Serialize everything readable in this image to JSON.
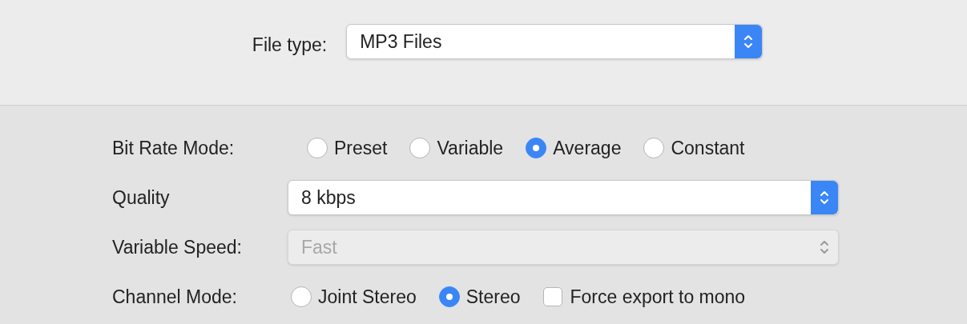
{
  "file_type": {
    "label": "File type:",
    "value": "MP3 Files"
  },
  "options": [
    {
      "kind": "radio",
      "label": "Bit Rate Mode:",
      "choices": [
        {
          "label": "Preset",
          "selected": false
        },
        {
          "label": "Variable",
          "selected": false
        },
        {
          "label": "Average",
          "selected": true
        },
        {
          "label": "Constant",
          "selected": false
        }
      ]
    },
    {
      "kind": "select",
      "label": "Quality",
      "value": "8 kbps",
      "disabled": false
    },
    {
      "kind": "select",
      "label": "Variable Speed:",
      "value": "Fast",
      "disabled": true
    },
    {
      "kind": "radio",
      "label": "Channel Mode:",
      "choices": [
        {
          "label": "Joint Stereo",
          "selected": false
        },
        {
          "label": "Stereo",
          "selected": true
        }
      ],
      "checkbox": {
        "label": "Force export to mono",
        "checked": false
      }
    }
  ]
}
